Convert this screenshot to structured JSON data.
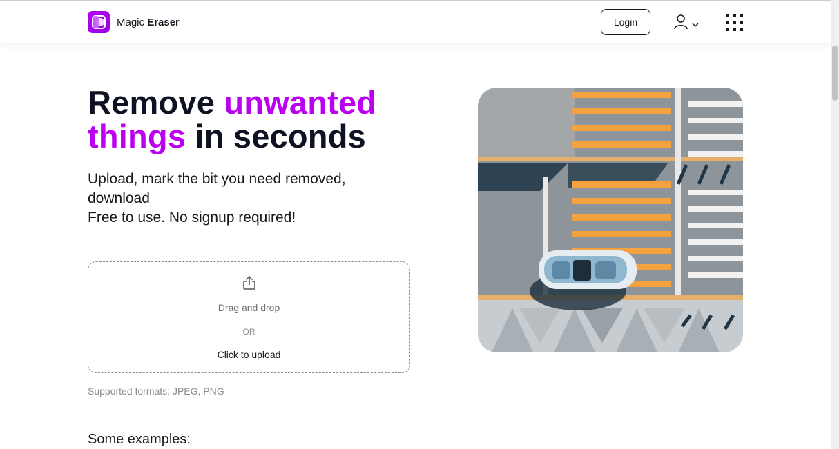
{
  "header": {
    "logo_prefix": "Magic",
    "logo_bold": "Eraser",
    "login_label": "Login"
  },
  "hero": {
    "title_part1": "Remove ",
    "title_accent1": "unwanted",
    "title_accent2": "things",
    "title_part2": " in seconds",
    "subtitle_line1": "Upload, mark the bit you need removed, download",
    "subtitle_line2": "Free to use. No signup required!"
  },
  "upload": {
    "drag_text": "Drag and drop",
    "or_text": "OR",
    "click_text": "Click to upload",
    "formats": "Supported formats: JPEG, PNG"
  },
  "examples_heading": "Some examples:",
  "colors": {
    "accent": "#bb00f2",
    "text": "#0f1222"
  },
  "icons": [
    "logo-icon",
    "user-icon",
    "chevron-down-icon",
    "apps-grid-icon",
    "upload-icon"
  ]
}
